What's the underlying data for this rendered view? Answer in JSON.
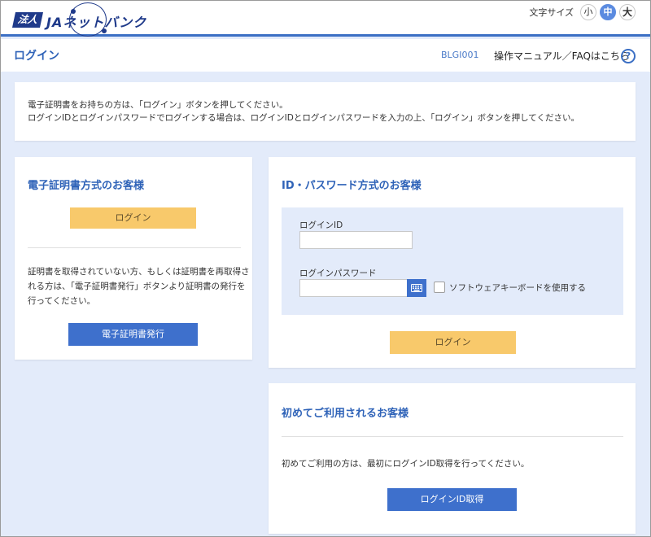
{
  "header": {
    "logo_box": "法人",
    "logo_brand": "JAネットバンク",
    "font_size_label": "文字サイズ",
    "font_sizes": [
      "小",
      "中",
      "大"
    ],
    "font_size_selected": "中"
  },
  "page": {
    "title": "ログイン",
    "screen_code": "BLGI001",
    "manual_link": "操作マニュアル／FAQはこちら",
    "help_icon": "?"
  },
  "notice": {
    "line1": "電子証明書をお持ちの方は、「ログイン」ボタンを押してください。",
    "line2": "ログインIDとログインパスワードでログインする場合は、ログインIDとログインパスワードを入力の上、「ログイン」ボタンを押してください。"
  },
  "certificate": {
    "heading": "電子証明書方式のお客様",
    "login_button": "ログイン",
    "description": "証明書を取得されていない方、もしくは証明書を再取得される方は、「電子証明書発行」ボタンより証明書の発行を行ってください。",
    "issue_button": "電子証明書発行"
  },
  "id_password": {
    "heading": "ID・パスワード方式のお客様",
    "login_id_label": "ログインID",
    "login_id_value": "",
    "password_label": "ログインパスワード",
    "password_value": "",
    "software_keyboard_label": "ソフトウェアキーボードを使用する",
    "software_keyboard_checked": false,
    "login_button": "ログイン"
  },
  "first_time": {
    "heading": "初めてご利用されるお客様",
    "description": "初めてご利用の方は、最初にログインID取得を行ってください。",
    "get_id_button": "ログインID取得"
  },
  "colors": {
    "accent": "#3e70cc",
    "yellow_button": "#f8c96b",
    "background": "#e3ebfa"
  },
  "icons": [
    "help-icon",
    "keyboard-icon"
  ]
}
